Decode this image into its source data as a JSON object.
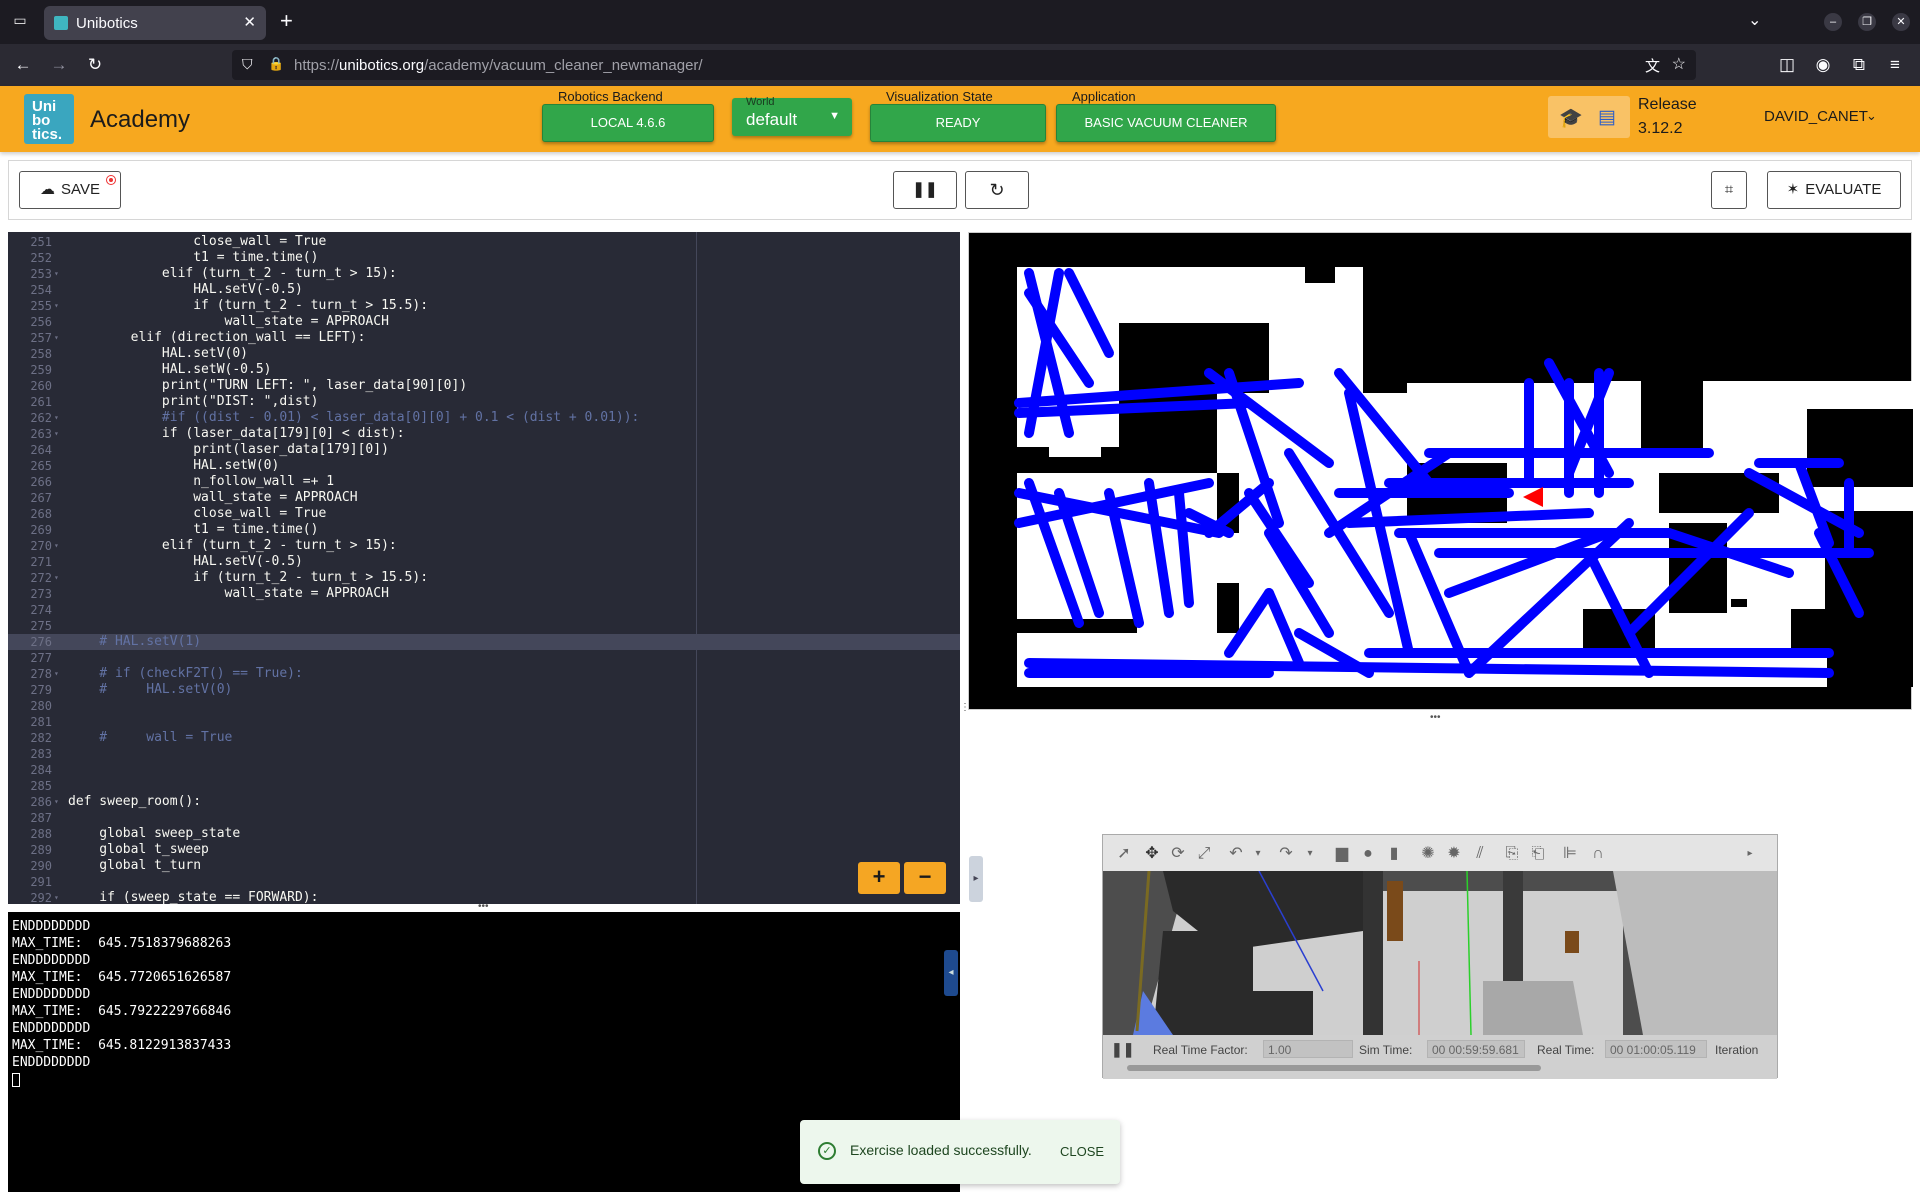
{
  "browser": {
    "tab_title": "Unibotics",
    "url_prefix": "https://",
    "url_host": "unibotics.org",
    "url_path": "/academy/vacuum_cleaner_newmanager/"
  },
  "header": {
    "logo_lines": [
      "Uni",
      "bo",
      "tics."
    ],
    "app_title": "Academy",
    "backend_label": "Robotics Backend",
    "backend_value": "LOCAL 4.6.6",
    "world_label": "World",
    "world_value": "default",
    "vis_label": "Visualization State",
    "vis_value": "READY",
    "app_label": "Application",
    "app_value": "BASIC VACUUM CLEANER",
    "release_label": "Release",
    "release_value": "3.12.2",
    "user": "DAVID_CANET"
  },
  "toolbar": {
    "save_label": "SAVE",
    "evaluate_label": "EVALUATE"
  },
  "editor": {
    "lines": [
      {
        "n": "251",
        "t": "                close_wall = True"
      },
      {
        "n": "252",
        "t": "                t1 = time.time()"
      },
      {
        "n": "253",
        "t": "            elif (turn_t_2 - turn_t > 15):",
        "fold": true
      },
      {
        "n": "254",
        "t": "                HAL.setV(-0.5)"
      },
      {
        "n": "255",
        "t": "                if (turn_t_2 - turn_t > 15.5):",
        "fold": true
      },
      {
        "n": "256",
        "t": "                    wall_state = APPROACH"
      },
      {
        "n": "257",
        "t": "        elif (direction_wall == LEFT):",
        "fold": true
      },
      {
        "n": "258",
        "t": "            HAL.setV(0)"
      },
      {
        "n": "259",
        "t": "            HAL.setW(-0.5)"
      },
      {
        "n": "260",
        "t": "            print(\"TURN LEFT: \", laser_data[90][0])"
      },
      {
        "n": "261",
        "t": "            print(\"DIST: \",dist)"
      },
      {
        "n": "262",
        "t": "            #if ((dist - 0.01) < laser_data[0][0] + 0.1 < (dist + 0.01)):",
        "fold": true
      },
      {
        "n": "263",
        "t": "            if (laser_data[179][0] < dist):",
        "fold": true
      },
      {
        "n": "264",
        "t": "                print(laser_data[179][0])"
      },
      {
        "n": "265",
        "t": "                HAL.setW(0)"
      },
      {
        "n": "266",
        "t": "                n_follow_wall =+ 1"
      },
      {
        "n": "267",
        "t": "                wall_state = APPROACH"
      },
      {
        "n": "268",
        "t": "                close_wall = True"
      },
      {
        "n": "269",
        "t": "                t1 = time.time()"
      },
      {
        "n": "270",
        "t": "            elif (turn_t_2 - turn_t > 15):",
        "fold": true
      },
      {
        "n": "271",
        "t": "                HAL.setV(-0.5)"
      },
      {
        "n": "272",
        "t": "                if (turn_t_2 - turn_t > 15.5):",
        "fold": true
      },
      {
        "n": "273",
        "t": "                    wall_state = APPROACH"
      },
      {
        "n": "274",
        "t": ""
      },
      {
        "n": "275",
        "t": ""
      },
      {
        "n": "276",
        "t": "    # HAL.setV(1)",
        "active": true
      },
      {
        "n": "277",
        "t": ""
      },
      {
        "n": "278",
        "t": "    # if (checkF2T() == True):",
        "fold": true
      },
      {
        "n": "279",
        "t": "    #     HAL.setV(0)"
      },
      {
        "n": "280",
        "t": ""
      },
      {
        "n": "281",
        "t": ""
      },
      {
        "n": "282",
        "t": "    #     wall = True"
      },
      {
        "n": "283",
        "t": ""
      },
      {
        "n": "284",
        "t": ""
      },
      {
        "n": "285",
        "t": ""
      },
      {
        "n": "286",
        "t": "def sweep_room():",
        "fold": true
      },
      {
        "n": "287",
        "t": ""
      },
      {
        "n": "288",
        "t": "    global sweep_state"
      },
      {
        "n": "289",
        "t": "    global t_sweep"
      },
      {
        "n": "290",
        "t": "    global t_turn"
      },
      {
        "n": "291",
        "t": ""
      },
      {
        "n": "292",
        "t": "    if (sweep_state == FORWARD):",
        "fold": true
      }
    ]
  },
  "terminal": {
    "lines": [
      "ENDDDDDDDD",
      "MAX_TIME:  645.7518379688263",
      "ENDDDDDDDD",
      "MAX_TIME:  645.7720651626587",
      "ENDDDDDDDD",
      "MAX_TIME:  645.7922229766846",
      "ENDDDDDDDD",
      "MAX_TIME:  645.8122913837433",
      "ENDDDDDDDD"
    ]
  },
  "gazebo": {
    "rtf_label": "Real Time Factor:",
    "rtf_value": "1.00",
    "sim_label": "Sim Time:",
    "sim_value": "00 00:59:59.681",
    "real_label": "Real Time:",
    "real_value": "00 01:00:05.119",
    "iter_label": "Iteration"
  },
  "snackbar": {
    "message": "Exercise loaded successfully.",
    "close": "CLOSE"
  },
  "colors": {
    "header_bg": "#f7a81f",
    "green_button": "#31a64a",
    "map_path": "#0000ff",
    "robot": "#ff0000"
  }
}
